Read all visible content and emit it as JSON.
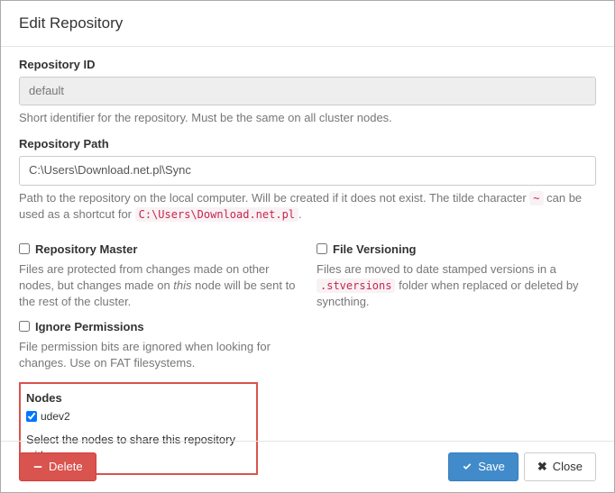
{
  "modal": {
    "title": "Edit Repository"
  },
  "repo_id": {
    "label": "Repository ID",
    "value": "default",
    "help": "Short identifier for the repository. Must be the same on all cluster nodes."
  },
  "repo_path": {
    "label": "Repository Path",
    "value": "C:\\Users\\Download.net.pl\\Sync",
    "help_prefix": "Path to the repository on the local computer. Will be created if it does not exist. The tilde character ",
    "help_tilde": "~",
    "help_mid": " can be used as a shortcut for ",
    "help_code": "C:\\Users\\Download.net.pl",
    "help_suffix": "."
  },
  "repo_master": {
    "label": "Repository Master",
    "help_prefix": "Files are protected from changes made on other nodes, but changes made on ",
    "help_em": "this",
    "help_suffix": " node will be sent to the rest of the cluster."
  },
  "file_versioning": {
    "label": "File Versioning",
    "help_prefix": "Files are moved to date stamped versions in a ",
    "help_code": ".stversions",
    "help_suffix": " folder when replaced or deleted by syncthing."
  },
  "ignore_perms": {
    "label": "Ignore Permissions",
    "help": "File permission bits are ignored when looking for changes. Use on FAT filesystems."
  },
  "nodes": {
    "label": "Nodes",
    "items": [
      {
        "name": "udev2",
        "checked": true
      }
    ],
    "help": "Select the nodes to share this repository with."
  },
  "buttons": {
    "delete": "Delete",
    "save": "Save",
    "close": "Close"
  }
}
